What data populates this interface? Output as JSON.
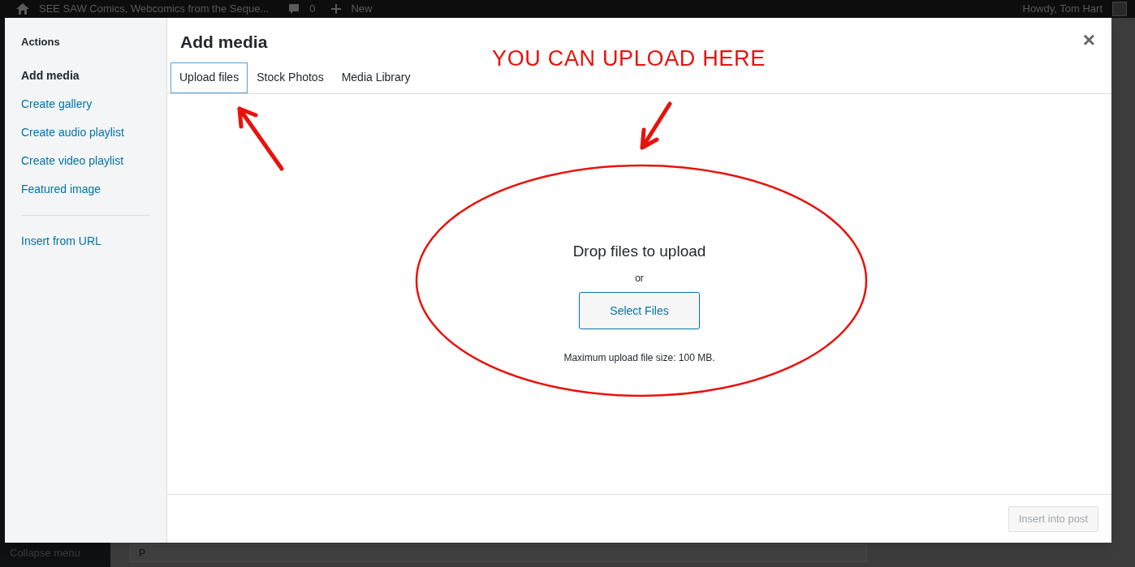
{
  "admin_bar": {
    "site_title": "SEE SAW Comics, Webcomics from the Seque...",
    "comments_count": "0",
    "new_label": "New",
    "greeting": "Howdy, Tom Hart"
  },
  "background": {
    "menu_label": "Collapse menu",
    "editor_text": "P"
  },
  "modal": {
    "title": "Add media",
    "close": "×",
    "sidebar": {
      "heading": "Actions",
      "items": [
        {
          "label": "Add media",
          "selected": true
        },
        {
          "label": "Create gallery",
          "selected": false
        },
        {
          "label": "Create audio playlist",
          "selected": false
        },
        {
          "label": "Create video playlist",
          "selected": false
        },
        {
          "label": "Featured image",
          "selected": false
        }
      ],
      "extra_items": [
        {
          "label": "Insert from URL",
          "selected": false
        }
      ]
    },
    "tabs": [
      {
        "label": "Upload files",
        "selected": true
      },
      {
        "label": "Stock Photos",
        "selected": false
      },
      {
        "label": "Media Library",
        "selected": false
      }
    ],
    "upload": {
      "heading": "Drop files to upload",
      "or": "or",
      "button": "Select Files",
      "note": "Maximum upload file size: 100 MB."
    },
    "footer": {
      "button": "Insert into post",
      "disabled": true
    }
  },
  "annotation": {
    "text": "YOU CAN UPLOAD HERE"
  }
}
